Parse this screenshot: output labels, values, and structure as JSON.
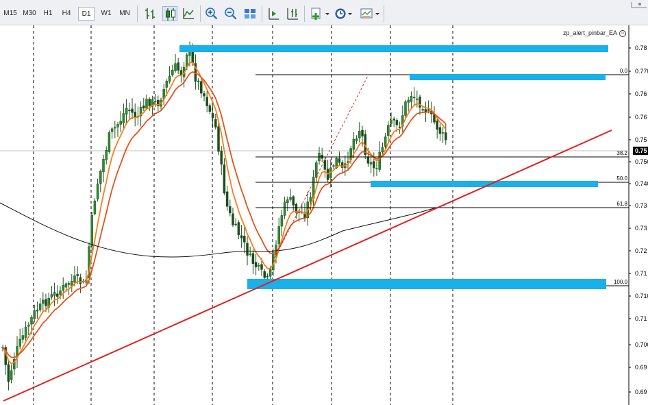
{
  "toolbar": {
    "timeframes": [
      "M15",
      "M30",
      "H1",
      "H4",
      "D1",
      "W1",
      "MN"
    ],
    "active_timeframe": "D1"
  },
  "chart": {
    "ea_label": "zp_alert_pinbar_EA",
    "current_price_label": "0.75",
    "price_ticks": [
      "0.78",
      "0.770",
      "0.76",
      "0.76",
      "0.75",
      "0.750",
      "0.740",
      "0.73",
      "0.73",
      "0.72",
      "0.71",
      "0.710",
      "0.71",
      "0.700",
      "0.69",
      "0.69",
      "0.68"
    ],
    "fib_levels": [
      "0.0",
      "38.2",
      "50.0",
      "61.8",
      "100.0"
    ],
    "colors": {
      "background": "#ffffff",
      "candle_up": "#2f8b2f",
      "candle_down": "#1a4e1a",
      "ma_fast": "#ff7a1a",
      "ma_slow": "#e2521c",
      "ma_long": "#111111",
      "zone": "#1ab0ea",
      "trendline": "#e02020",
      "grid": "#000000"
    }
  }
}
